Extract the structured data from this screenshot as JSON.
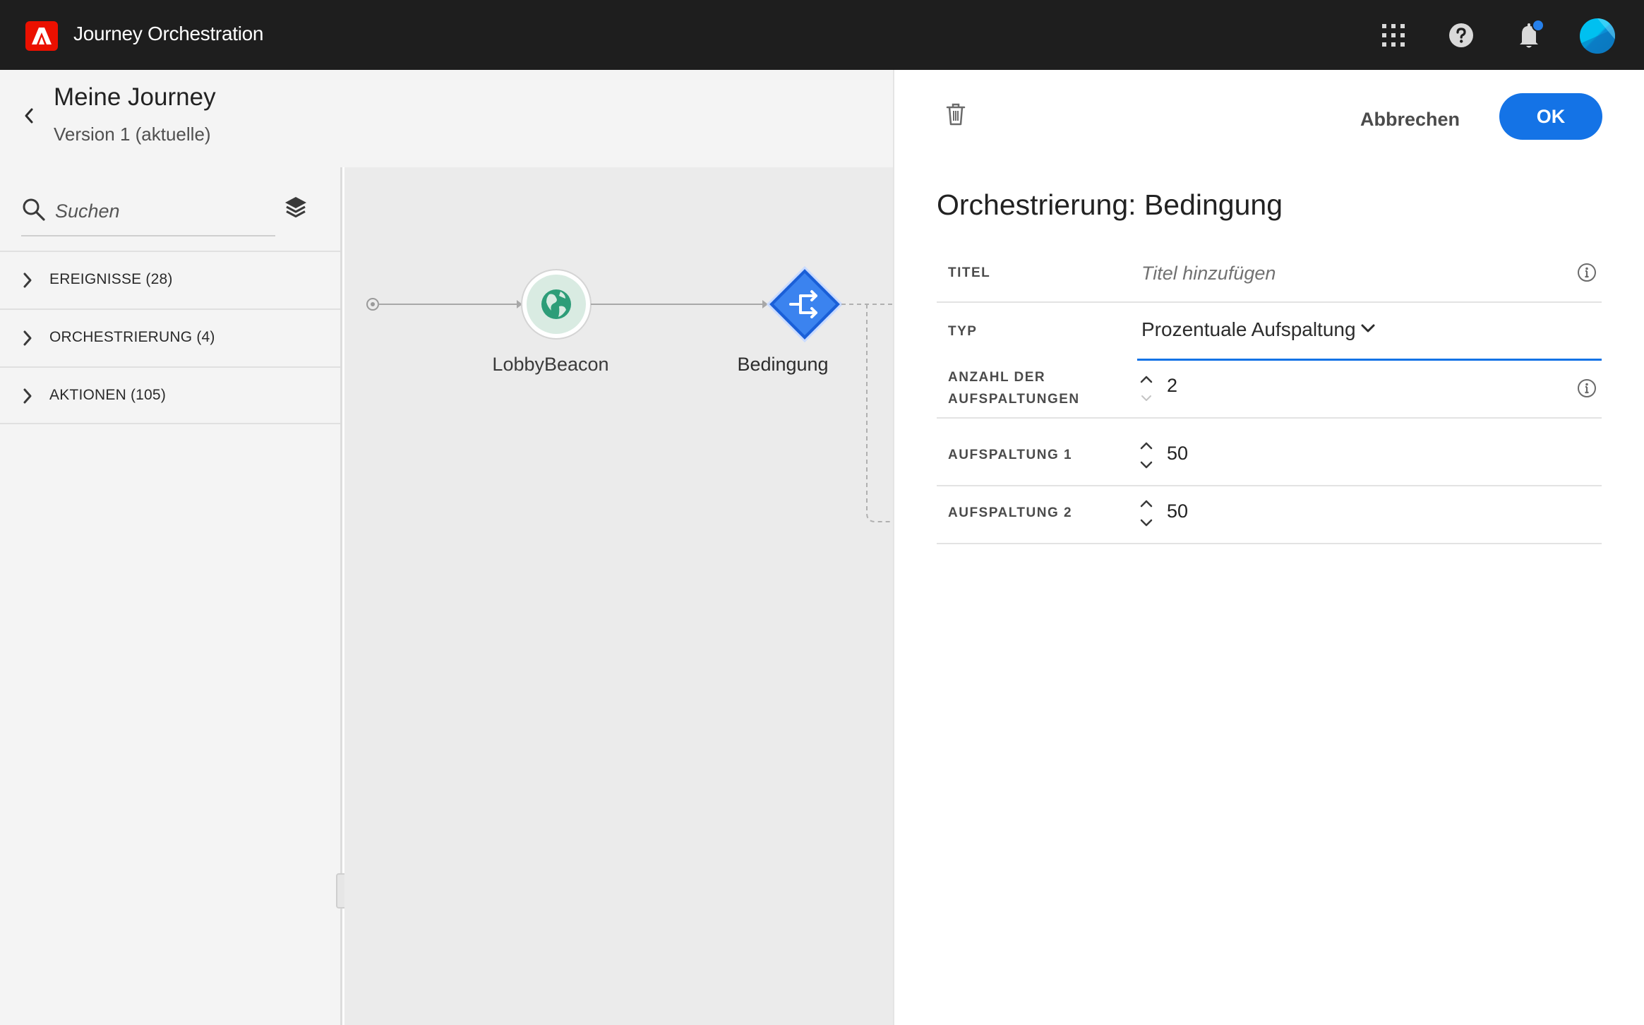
{
  "app": {
    "title": "Journey Orchestration",
    "accent_color": "#1473e6",
    "brand_color": "#eb1000"
  },
  "topbar": {
    "icons": [
      "apps-grid-icon",
      "help-icon",
      "notification-bell-icon",
      "user-avatar"
    ]
  },
  "journey": {
    "title": "Meine Journey",
    "version": "Version 1 (aktuelle)"
  },
  "sidebar": {
    "search_placeholder": "Suchen",
    "categories": [
      {
        "label": "EREIGNISSE (28)"
      },
      {
        "label": "ORCHESTRIERUNG (4)"
      },
      {
        "label": "AKTIONEN (105)"
      }
    ]
  },
  "canvas": {
    "nodes": [
      {
        "label": "LobbyBeacon",
        "icon": "globe-icon"
      },
      {
        "label": "Bedingung",
        "icon": "condition-split-icon"
      }
    ]
  },
  "panel": {
    "cancel_label": "Abbrechen",
    "ok_label": "OK",
    "title": "Orchestrierung: Bedingung",
    "fields": {
      "titel": {
        "label": "TITEL",
        "placeholder": "Titel hinzufügen"
      },
      "typ": {
        "label": "TYP",
        "value": "Prozentuale Aufspaltung"
      },
      "anzahl": {
        "label_line1": "ANZAHL DER",
        "label_line2": "AUFSPALTUNGEN",
        "value": "2"
      },
      "split1": {
        "label": "AUFSPALTUNG 1",
        "value": "50"
      },
      "split2": {
        "label": "AUFSPALTUNG 2",
        "value": "50"
      }
    }
  }
}
